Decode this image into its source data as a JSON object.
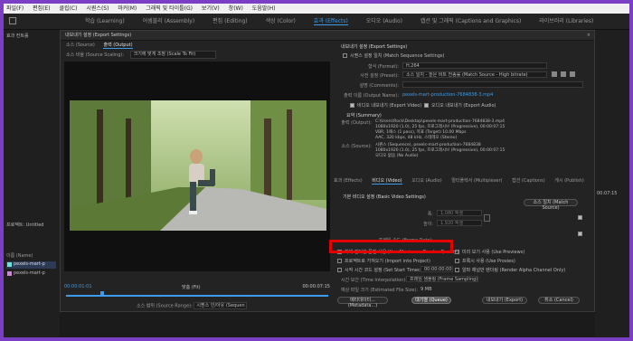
{
  "menubar": [
    "파일(F)",
    "편집(E)",
    "클립(C)",
    "시퀀스(S)",
    "마커(M)",
    "그래픽 및 타이틀(G)",
    "보기(V)",
    "창(W)",
    "도움말(H)"
  ],
  "workspaces": [
    {
      "label": "학습 (Learning)",
      "active": false
    },
    {
      "label": "어셈블리 (Assembly)",
      "active": false
    },
    {
      "label": "편집 (Editing)",
      "active": false
    },
    {
      "label": "색상 (Color)",
      "active": false
    },
    {
      "label": "효과 (Effects)",
      "active": true
    },
    {
      "label": "오디오 (Audio)",
      "active": false
    },
    {
      "label": "캡션 및 그래픽 (Captions and Graphics)",
      "active": false
    },
    {
      "label": "라이브러리 (Libraries)",
      "active": false
    }
  ],
  "dialog": {
    "title": "내보내기 설정 (Export Settings)",
    "close": "×",
    "source_tab": "소스 (Source)",
    "output_tab": "출력 (Output)",
    "scaling_label": "소스 비율 (Source Scaling):",
    "scaling_value": "크기에 맞게 조정 (Scale To Fit)",
    "timecode_in": "00:00:01:01",
    "timecode_out": "00:00:07:15",
    "fit_value": "맞춤 (Fit)",
    "source_range_label": "소스 범위 (Source Range):",
    "source_range_value": "시퀀스 인/아웃 (Sequen"
  },
  "export": {
    "section_title": "내보내기 설정 (Export Settings)",
    "match_sequence": "시퀀스 설정 일치 (Match Sequence Settings)",
    "format_label": "형식 (Format):",
    "format_value": "H.264",
    "preset_label": "사전 설정 (Preset):",
    "preset_value": "소스 일치 - 높은 비트 전송률 (Match Source - High bitrate)",
    "comments_label": "설명 (Comments):",
    "output_name_label": "출력 이름 (Output Name):",
    "output_name_value": "pexels-mart-production-7684838-3.mp4",
    "export_video": "비디오 내보내기 (Export Video)",
    "export_audio": "오디오 내보내기 (Export Audio)",
    "summary_title": "요약 (Summary)",
    "summary_output_label": "출력 (Output):",
    "summary_output_lines": [
      "C:\\Users\\Rock\\Desktop\\pexels-mart-production-7684838-3.mp4",
      "1080x1920 (1.0), 25 fps, 프로그레시브 (Progressive), 00:00:07:15",
      "VBR, 1패스 (1 pass), 목표 (Target) 10.00 Mbps",
      "AAC, 320 kbps, 48 kHz, 스테레오 (Stereo)"
    ],
    "summary_source_label": "소스 (Source):",
    "summary_source_lines": [
      "시퀀스 (Sequence), pexels-mart-production-7684838",
      "1080x1920 (1.0), 25 fps, 프로그레시브 (Progressive), 00:00:07:15",
      "오디오 없음 (No Audio)"
    ],
    "tabs": [
      {
        "label": "효과 (Effects)",
        "active": false
      },
      {
        "label": "비디오 (Video)",
        "active": true
      },
      {
        "label": "오디오 (Audio)",
        "active": false
      },
      {
        "label": "멀티플렉서 (Multiplexer)",
        "active": false
      },
      {
        "label": "캡션 (Captions)",
        "active": false
      },
      {
        "label": "게시 (Publish)",
        "active": false
      }
    ],
    "basic_video_title": "기본 비디오 설정 (Basic Video Settings)",
    "match_source_btn": "소스 일치 (Match Source)",
    "width_label": "폭:",
    "width_value": "1,080 픽셀",
    "height_label": "높이:",
    "height_value": "1,920 픽셀",
    "frame_rate_label": "프레임 속도 (Frame Rate):",
    "max_render_quality": "최대 렌더링 품질 사용 (Use Maximum Render Quality)",
    "use_previews": "미리 보기 사용 (Use Previews)",
    "import_into_project": "프로젝트로 가져오기 (Import into Project)",
    "use_proxies": "프록시 사용 (Use Proxies)",
    "set_start_timecode": "시작 시간 코드 설정 (Set Start Timecode)",
    "start_timecode_value": "00:00:00:00",
    "render_alpha": "알파 채널만 렌더링 (Render Alpha Channel Only)",
    "time_interp_label": "시간 보간 (Time Interpolation):",
    "time_interp_value": "프레임 샘플링 (Frame Sampling)",
    "file_size_label": "예상 파일 크기 (Estimated File Size):",
    "file_size_value": "9 MB",
    "metadata_btn": "메타데이터... (Metadata...)",
    "queue_btn": "대기열 (Queue)",
    "export_btn": "내보내기 (Export)",
    "cancel_btn": "취소 (Cancel)"
  },
  "left_panel": {
    "title": "효과 컨트롤",
    "project_label": "프로젝트: Untitled",
    "name_header": "이름 (Name)",
    "items": [
      "pexels-mart-p",
      "pexels-mart-p"
    ]
  },
  "right_panel": {
    "time": "00:07:15"
  },
  "colors": {
    "accent": "#3d9be9",
    "highlight": "#e40000",
    "background": "#7a3fc4"
  }
}
